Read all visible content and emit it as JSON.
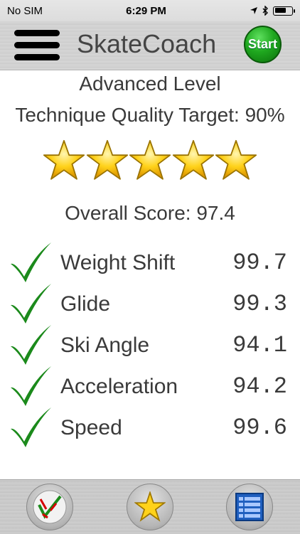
{
  "status": {
    "carrier": "No SIM",
    "time": "6:29 PM",
    "battery_level": 0.7
  },
  "header": {
    "title": "SkateCoach",
    "start_label": "Start"
  },
  "level": {
    "title": "Advanced Level",
    "target_text": "Technique Quality Target: 90%"
  },
  "rating": {
    "stars": 5,
    "max": 5
  },
  "score": {
    "text": "Overall Score: 97.4"
  },
  "metrics": [
    {
      "label": "Weight Shift",
      "value": "99.7"
    },
    {
      "label": "Glide",
      "value": "99.3"
    },
    {
      "label": "Ski Angle",
      "value": "94.1"
    },
    {
      "label": "Acceleration",
      "value": "94.2"
    },
    {
      "label": "Speed",
      "value": "99.6"
    }
  ],
  "tabs": [
    {
      "icon": "technique-chart-icon"
    },
    {
      "icon": "star-icon"
    },
    {
      "icon": "list-icon"
    }
  ],
  "colors": {
    "check": "#1b8a1b",
    "star_fill": "#ffd21a",
    "start_button": "#1fa81f"
  }
}
